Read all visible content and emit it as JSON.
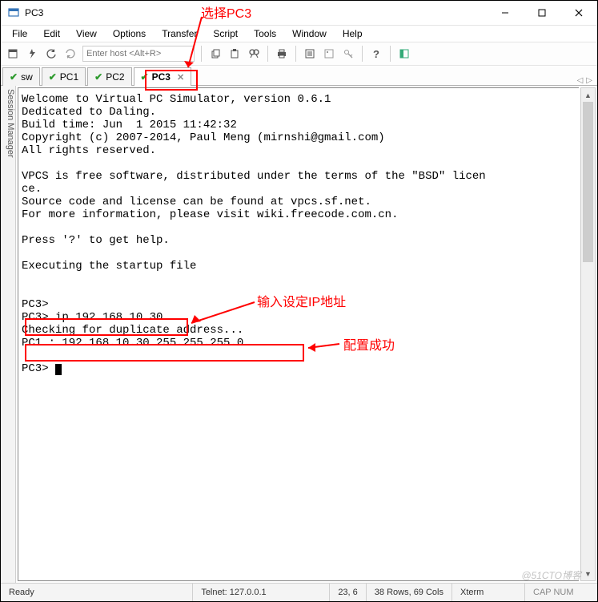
{
  "titlebar": {
    "title": "PC3"
  },
  "menu": {
    "file": "File",
    "edit": "Edit",
    "view": "View",
    "options": "Options",
    "transfer": "Transfer",
    "script": "Script",
    "tools": "Tools",
    "window": "Window",
    "help": "Help"
  },
  "toolbar": {
    "host_placeholder": "Enter host <Alt+R>"
  },
  "tabs": {
    "items": [
      {
        "label": "sw",
        "active": false
      },
      {
        "label": "PC1",
        "active": false
      },
      {
        "label": "PC2",
        "active": false
      },
      {
        "label": "PC3",
        "active": true
      }
    ]
  },
  "sidebar": {
    "label": "Session Manager"
  },
  "terminal": {
    "l1": "Welcome to Virtual PC Simulator, version 0.6.1",
    "l2": "Dedicated to Daling.",
    "l3": "Build time: Jun  1 2015 11:42:32",
    "l4": "Copyright (c) 2007-2014, Paul Meng (mirnshi@gmail.com)",
    "l5": "All rights reserved.",
    "l6": "",
    "l7": "VPCS is free software, distributed under the terms of the \"BSD\" licen",
    "l8": "ce.",
    "l9": "Source code and license can be found at vpcs.sf.net.",
    "l10": "For more information, please visit wiki.freecode.com.cn.",
    "l11": "",
    "l12": "Press '?' to get help.",
    "l13": "",
    "l14": "Executing the startup file",
    "l15": "",
    "l16": "",
    "l17": "PC3>",
    "l18": "PC3> ip 192.168.10.30",
    "l19": "Checking for duplicate address...",
    "l20": "PC1 : 192.168.10.30 255.255.255.0",
    "l21": "",
    "l22": "PC3> "
  },
  "status": {
    "ready": "Ready",
    "telnet": "Telnet: 127.0.0.1",
    "cursor": "23,  6",
    "size": "38 Rows, 69 Cols",
    "term": "Xterm",
    "caps": "CAP  NUM"
  },
  "annotations": {
    "select_pc3": "选择PC3",
    "input_ip": "输入设定IP地址",
    "config_ok": "配置成功"
  },
  "watermark": "@51CTO博客"
}
